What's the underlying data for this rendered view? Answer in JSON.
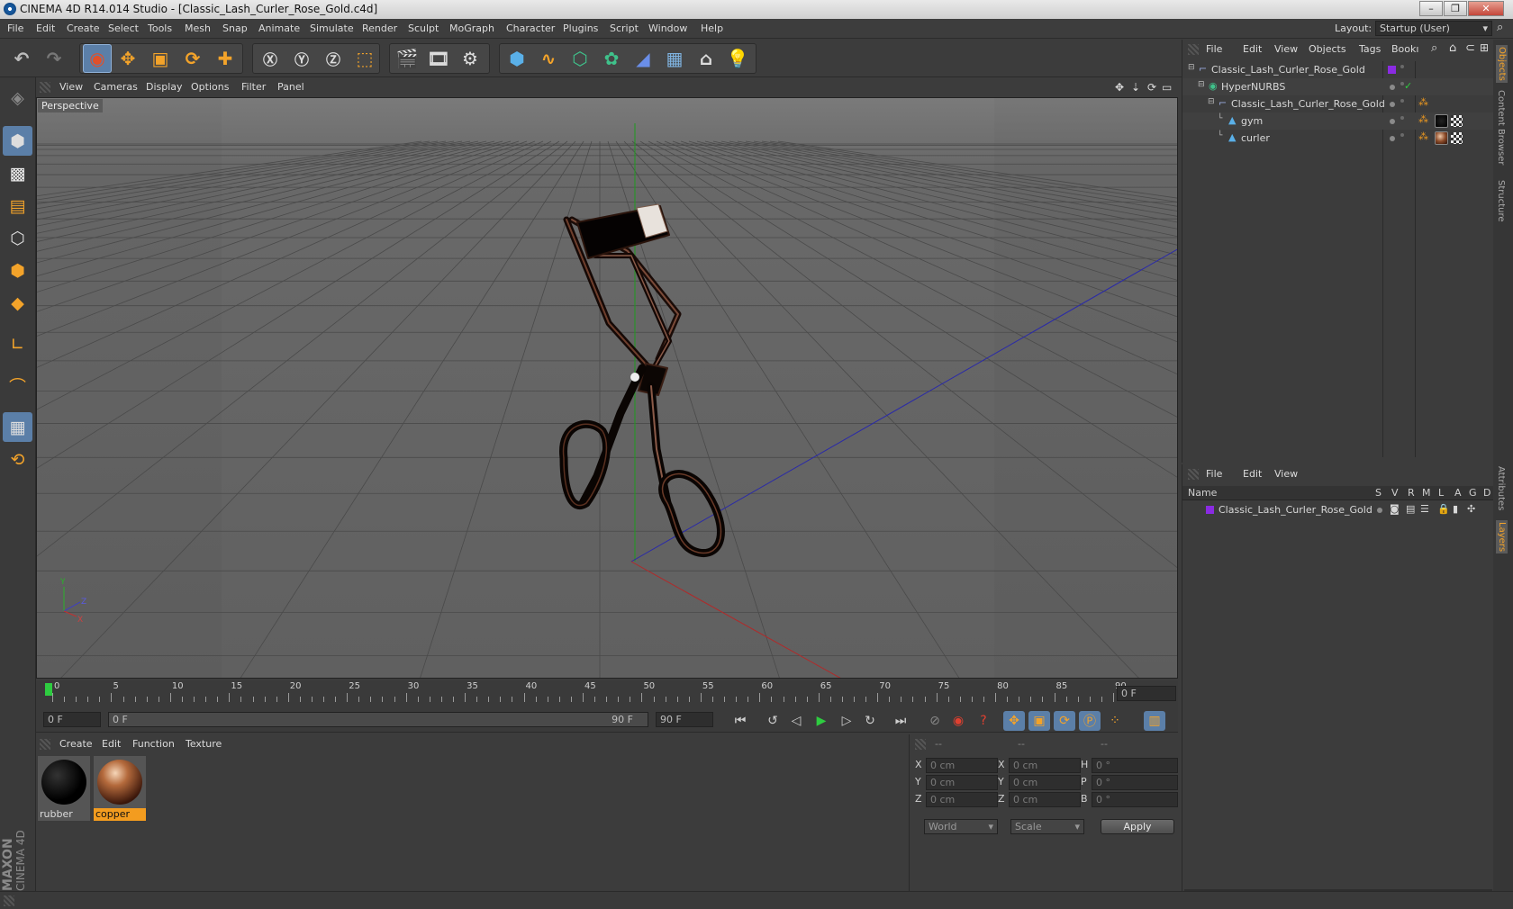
{
  "app": {
    "title": "CINEMA 4D R14.014 Studio - [Classic_Lash_Curler_Rose_Gold.c4d]"
  },
  "menu": [
    "File",
    "Edit",
    "Create",
    "Select",
    "Tools",
    "Mesh",
    "Snap",
    "Animate",
    "Simulate",
    "Render",
    "Sculpt",
    "MoGraph",
    "Character",
    "Plugins",
    "Script",
    "Window",
    "Help"
  ],
  "layout": {
    "label": "Layout:",
    "value": "Startup (User)"
  },
  "viewport": {
    "menu": [
      "View",
      "Cameras",
      "Display",
      "Options",
      "Filter",
      "Panel"
    ],
    "label": "Perspective"
  },
  "timeline": {
    "ticks": [
      "0",
      "5",
      "10",
      "15",
      "20",
      "25",
      "30",
      "35",
      "40",
      "45",
      "50",
      "55",
      "60",
      "65",
      "70",
      "75",
      "80",
      "85",
      "90"
    ],
    "current_frame": "0 F"
  },
  "transport": {
    "start": "0 F",
    "range_start": "0 F",
    "range_end": "90 F",
    "end": "90 F"
  },
  "materials": {
    "menu": [
      "Create",
      "Edit",
      "Function",
      "Texture"
    ],
    "items": [
      {
        "name": "rubber"
      },
      {
        "name": "copper"
      }
    ]
  },
  "attributes": {
    "headers": [
      "--",
      "--",
      "--"
    ],
    "rows": [
      {
        "a": "X",
        "av": "0 cm",
        "b": "X",
        "bv": "0 cm",
        "c": "H",
        "cv": "0 °"
      },
      {
        "a": "Y",
        "av": "0 cm",
        "b": "Y",
        "bv": "0 cm",
        "c": "P",
        "cv": "0 °"
      },
      {
        "a": "Z",
        "av": "0 cm",
        "b": "Z",
        "bv": "0 cm",
        "c": "B",
        "cv": "0 °"
      }
    ],
    "coord_mode": "World",
    "size_mode": "Scale",
    "apply": "Apply"
  },
  "objects": {
    "menu": [
      "File",
      "Edit",
      "View",
      "Objects",
      "Tags",
      "Bookı"
    ],
    "tree": [
      {
        "name": "Classic_Lash_Curler_Rose_Gold",
        "indent": 0
      },
      {
        "name": "HyperNURBS",
        "indent": 1
      },
      {
        "name": "Classic_Lash_Curler_Rose_Gold",
        "indent": 2
      },
      {
        "name": "gym",
        "indent": 3
      },
      {
        "name": "curler",
        "indent": 3
      }
    ]
  },
  "layers": {
    "menu": [
      "File",
      "Edit",
      "View"
    ],
    "columns": [
      "Name",
      "S",
      "V",
      "R",
      "M",
      "L",
      "A",
      "G",
      "D"
    ],
    "rows": [
      {
        "name": "Classic_Lash_Curler_Rose_Gold"
      }
    ]
  },
  "side_tabs": [
    "Objects",
    "Content Browser",
    "Structure",
    "Attributes",
    "Layers"
  ],
  "brand": {
    "line1": "MAXON",
    "line2": "CINEMA 4D"
  },
  "colors": {
    "accent": "#f39c1f",
    "layer_purple": "#8a2be2",
    "selection": "#5b7fa8"
  }
}
